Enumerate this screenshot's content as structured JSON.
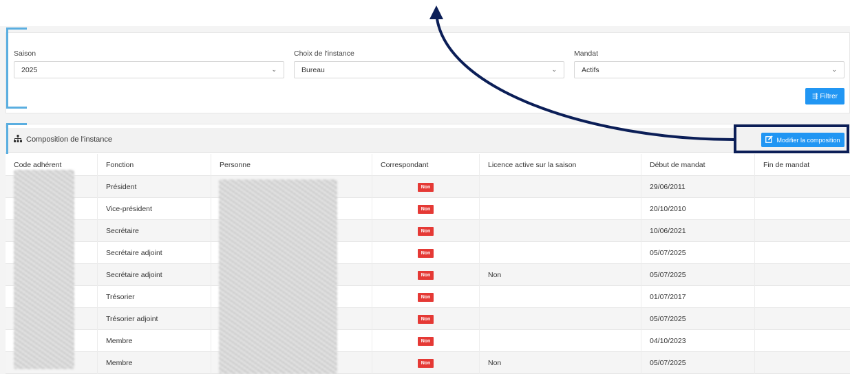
{
  "filters": {
    "saison": {
      "label": "Saison",
      "value": "2025"
    },
    "instance": {
      "label": "Choix de l'instance",
      "value": "Bureau"
    },
    "mandat": {
      "label": "Mandat",
      "value": "Actifs"
    },
    "filter_button": "Filtrer"
  },
  "composition": {
    "title": "Composition de l'instance",
    "modify_button": "Modifier la composition",
    "columns": [
      "Code adhérent",
      "Fonction",
      "Personne",
      "Correspondant",
      "Licence active sur la saison",
      "Début de mandat",
      "Fin de mandat"
    ],
    "rows": [
      {
        "fonction": "Président",
        "correspondant": "Non",
        "licence": "",
        "debut": "29/06/2011",
        "fin": ""
      },
      {
        "fonction": "Vice-président",
        "correspondant": "Non",
        "licence": "",
        "debut": "20/10/2010",
        "fin": ""
      },
      {
        "fonction": "Secrétaire",
        "correspondant": "Non",
        "licence": "",
        "debut": "10/06/2021",
        "fin": ""
      },
      {
        "fonction": "Secrétaire adjoint",
        "correspondant": "Non",
        "licence": "",
        "debut": "05/07/2025",
        "fin": ""
      },
      {
        "fonction": "Secrétaire adjoint",
        "correspondant": "Non",
        "licence": "Non",
        "debut": "05/07/2025",
        "fin": ""
      },
      {
        "fonction": "Trésorier",
        "correspondant": "Non",
        "licence": "",
        "debut": "01/07/2017",
        "fin": ""
      },
      {
        "fonction": "Trésorier adjoint",
        "correspondant": "Non",
        "licence": "",
        "debut": "05/07/2025",
        "fin": ""
      },
      {
        "fonction": "Membre",
        "correspondant": "Non",
        "licence": "",
        "debut": "04/10/2023",
        "fin": ""
      },
      {
        "fonction": "Membre",
        "correspondant": "Non",
        "licence": "Non",
        "debut": "05/07/2025",
        "fin": ""
      }
    ]
  },
  "colors": {
    "accent": "#2196f3",
    "badge": "#e53935",
    "bracket": "#5aaee0",
    "annotation": "#0b1e57"
  }
}
